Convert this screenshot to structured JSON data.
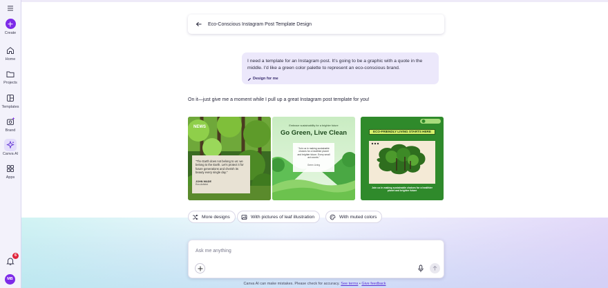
{
  "sidebar": {
    "items": [
      {
        "label": "Create",
        "icon": "plus-icon"
      },
      {
        "label": "Home",
        "icon": "home-icon"
      },
      {
        "label": "Projects",
        "icon": "folder-icon"
      },
      {
        "label": "Templates",
        "icon": "templates-icon"
      },
      {
        "label": "Brand",
        "icon": "brand-icon"
      },
      {
        "label": "Canva AI",
        "icon": "sparkle-icon"
      },
      {
        "label": "Apps",
        "icon": "apps-icon"
      }
    ],
    "notification_count": "6",
    "avatar_initials": "MB"
  },
  "header": {
    "title": "Eco-Conscious Instagram Post Template Design"
  },
  "chat": {
    "user_message": "I need a template for an Instagram post. It's going to be a graphic with a quote in the middle. I'd like a green color palette to represent an eco-conscious brand.",
    "user_chip": "Design for me",
    "ai_message": "On it—just give me a moment while I pull up a great Instagram post template for you!"
  },
  "templates": [
    {
      "header": "NEWS",
      "quote": "\"The Earth does not belong to us: we belong to the Earth. Let's protect it for future generations and cherish its beauty every single day.\"",
      "author": "JOHN WADE",
      "role": "Eco-Activist"
    },
    {
      "small_text": "Embrace sustainability for a brighter future",
      "headline": "Go Green, Live Clean",
      "body": "\"Join us in making sustainable choices for a healthier planet and brighter future. Every small act counts.\"",
      "sign": "Green Living"
    },
    {
      "banner": "ECO-FRIENDLY LIVING STARTS HERE",
      "caption": "Join us in making sustainable choices for a healthier planet and brighter future"
    }
  ],
  "suggestions": [
    {
      "label": "More designs",
      "icon": "shuffle-icon"
    },
    {
      "label": "With pictures of leaf illustration",
      "icon": "image-icon"
    },
    {
      "label": "With muted colors",
      "icon": "palette-icon"
    }
  ],
  "composer": {
    "placeholder": "Ask me anything"
  },
  "footer": {
    "text": "Canva AI can make mistakes. Please check for accuracy.",
    "link1": "See terms",
    "sep": "•",
    "link2": "Give feedback"
  },
  "colors": {
    "accent": "#7d2ae8",
    "leaf_green": "#2f8a2b",
    "light_green": "#a8dc7c",
    "badge_red": "#e0263c"
  }
}
